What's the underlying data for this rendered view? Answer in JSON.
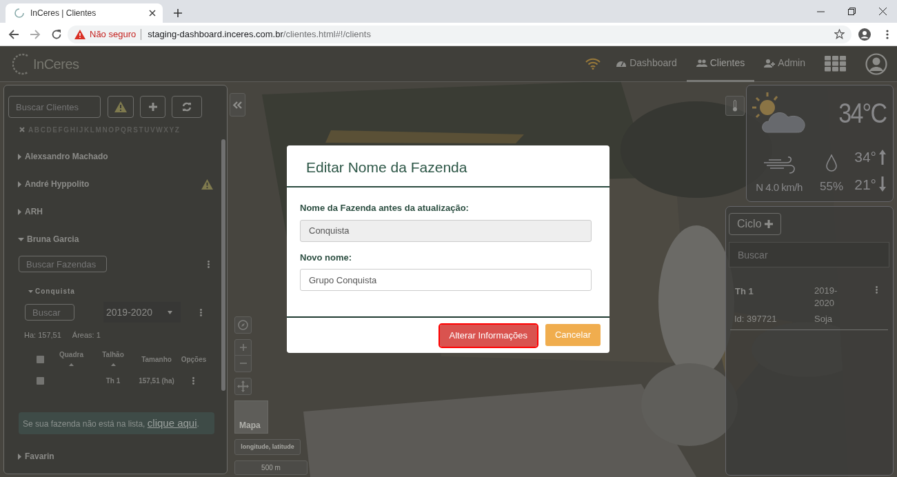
{
  "browser": {
    "tab_title": "InCeres | Clientes",
    "security_label": "Não seguro",
    "url_host": "staging-dashboard.inceres.com.br",
    "url_path": "/clientes.html#!/clients"
  },
  "navbar": {
    "logo": "InCeres",
    "items": [
      {
        "label": "Dashboard",
        "kind": "dashboard",
        "selected": false
      },
      {
        "label": "Clientes",
        "kind": "users",
        "selected": true
      },
      {
        "label": "Admin",
        "kind": "admin",
        "selected": false
      }
    ]
  },
  "clients_panel": {
    "search_placeholder": "Buscar Clientes",
    "alphabet": [
      "A",
      "B",
      "C",
      "D",
      "E",
      "F",
      "G",
      "H",
      "I",
      "J",
      "K",
      "L",
      "M",
      "N",
      "O",
      "P",
      "Q",
      "R",
      "S",
      "T",
      "U",
      "V",
      "W",
      "X",
      "Y",
      "Z"
    ],
    "clients": [
      {
        "name": "Alexsandro Machado",
        "expanded": false,
        "warning": false
      },
      {
        "name": "André Hyppolito",
        "expanded": false,
        "warning": true
      },
      {
        "name": "ARH",
        "expanded": false,
        "warning": false
      },
      {
        "name": "Bruna Garcia",
        "expanded": true,
        "warning": false,
        "farm_search_placeholder": "Buscar Fazendas",
        "farms": [
          {
            "name": "Conquista",
            "expanded": true,
            "search_placeholder": "Buscar",
            "season": "2019-2020",
            "area": "Ha: 157,51",
            "areas_count": "Áreas: 1",
            "select_all_checked": false,
            "columns": [
              {
                "label": "Quadra",
                "sortable": true
              },
              {
                "label": "Talhão",
                "sortable": true
              },
              {
                "label": "Tamanho",
                "sortable": false
              },
              {
                "label": "Opções",
                "sortable": false
              }
            ],
            "rows": [
              {
                "checked": false,
                "cells": [
                  "",
                  "Th 1",
                  "157,51 (ha)"
                ]
              }
            ]
          }
        ],
        "notice": {
          "text": "Se sua fazenda não está na lista, ",
          "link": "clique aqui",
          "end": "."
        }
      },
      {
        "name": "Favarin",
        "expanded": false,
        "warning": false
      }
    ]
  },
  "map_controls": {
    "minimap_label": "Mapa",
    "coordinates": "longitude, latitude",
    "scale": "500 m"
  },
  "weather": {
    "temperature": "34°C",
    "wind": "N 4.0 km/h",
    "humidity": "55%",
    "max": "34°",
    "min": "21°"
  },
  "cycles_panel": {
    "button": "Ciclo",
    "search_placeholder": "Buscar",
    "items": [
      {
        "name": "Th 1",
        "season": "2019-2020",
        "id": "Id: 397721",
        "crop": "Soja"
      }
    ]
  },
  "modal": {
    "title": "Editar Nome da Fazenda",
    "fields": [
      {
        "label": "Nome da Fazenda antes da atualização:",
        "value": "Conquista",
        "disabled": true
      },
      {
        "label": "Novo nome:",
        "value": "Grupo Conquista",
        "disabled": false
      }
    ],
    "buttons": [
      {
        "label": "Alterar Informações",
        "kind": "danger",
        "focused": true
      },
      {
        "label": "Cancelar",
        "kind": "warning",
        "focused": false
      }
    ]
  }
}
